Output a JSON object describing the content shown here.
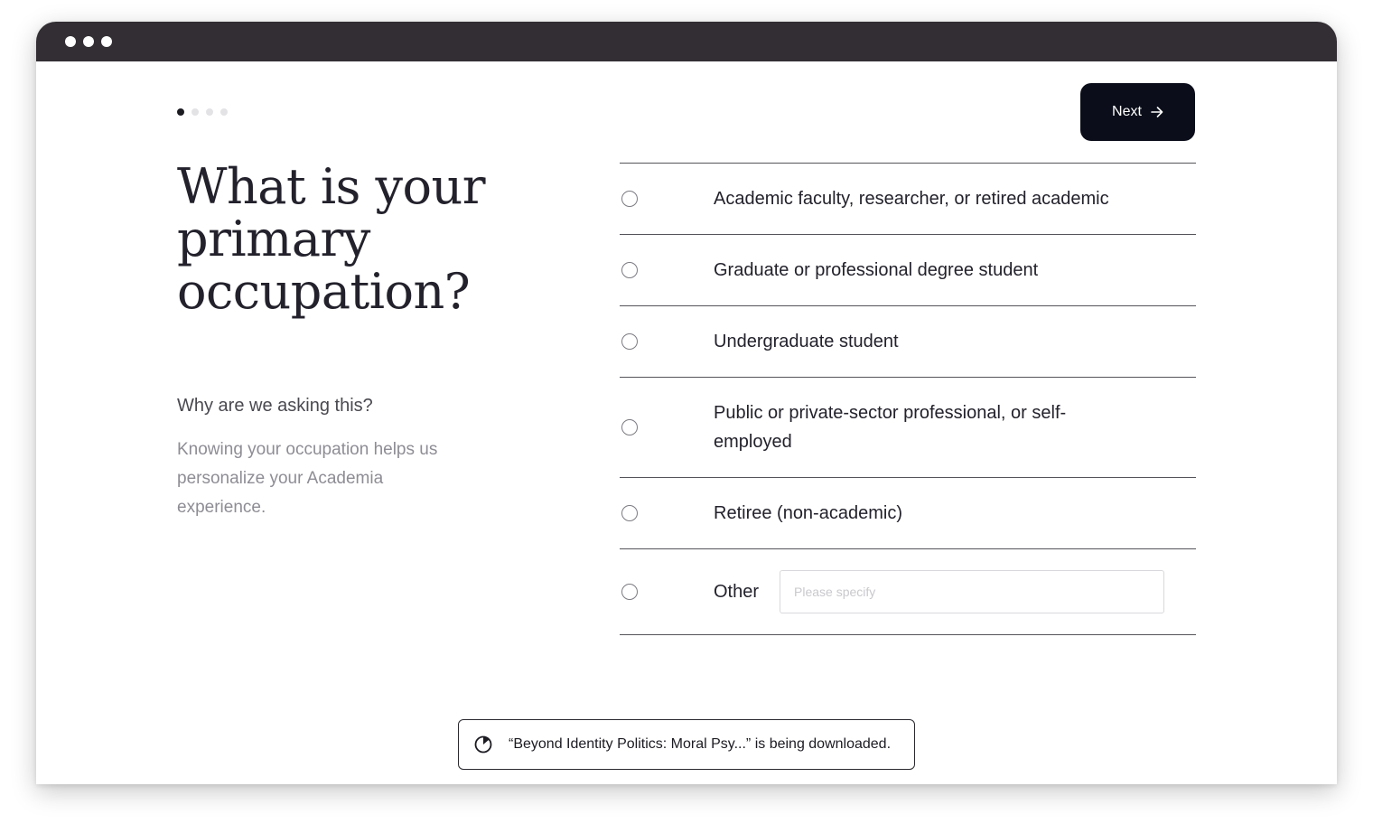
{
  "window": {
    "controls": [
      "dot",
      "dot",
      "dot"
    ]
  },
  "progress": {
    "total_steps": 4,
    "current_step": 1
  },
  "header": {
    "next_label": "Next",
    "next_icon": "arrow-right-icon"
  },
  "question": {
    "title": "What is your primary occupation?",
    "why_heading": "Why are we asking this?",
    "why_text": "Knowing your occupation helps us personalize your Academia experience."
  },
  "options": [
    {
      "label": "Academic faculty, researcher, or retired academic",
      "selected": false
    },
    {
      "label": "Graduate or professional degree student",
      "selected": false
    },
    {
      "label": "Undergraduate student",
      "selected": false
    },
    {
      "label": "Public or private-sector professional, or self-employed",
      "selected": false
    },
    {
      "label": "Retiree (non-academic)",
      "selected": false
    },
    {
      "label": "Other",
      "selected": false
    }
  ],
  "other_input": {
    "value": "",
    "placeholder": "Please specify"
  },
  "toast": {
    "icon": "progress-spinner-icon",
    "message": "“Beyond Identity Politics: Moral Psy...” is being downloaded."
  },
  "colors": {
    "titlebar": "#322e33",
    "primary_button": "#0b0e1a",
    "text": "#23212b",
    "muted_text": "#8e8d95"
  }
}
